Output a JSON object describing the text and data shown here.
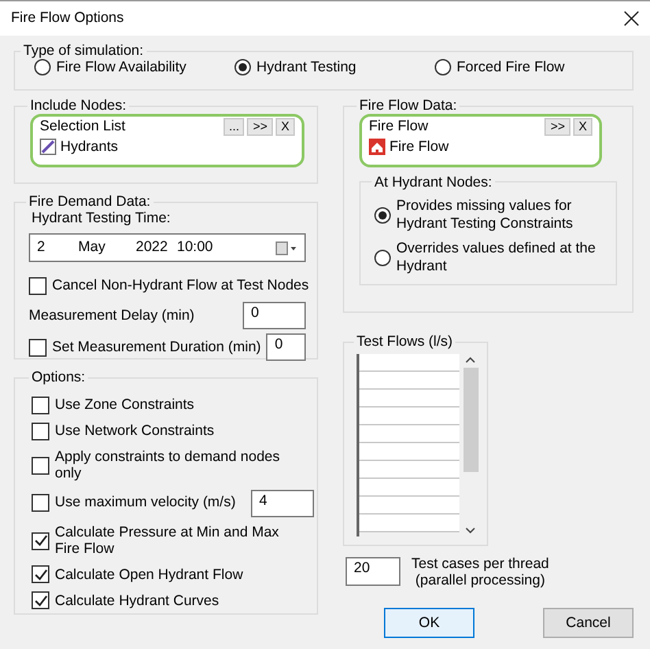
{
  "window": {
    "title": "Fire Flow Options"
  },
  "simulation_type": {
    "label": "Type of simulation:",
    "options": [
      {
        "label": "Fire Flow Availability",
        "selected": false
      },
      {
        "label": "Hydrant Testing",
        "selected": true
      },
      {
        "label": "Forced Fire Flow",
        "selected": false
      }
    ]
  },
  "include_nodes": {
    "label": "Include Nodes:",
    "list_title": "Selection List",
    "buttons": [
      "...",
      ">>",
      "X"
    ],
    "items": [
      {
        "label": "Hydrants",
        "kind": "hydrant"
      }
    ]
  },
  "fire_flow_data": {
    "label": "Fire Flow Data:",
    "list_title": "Fire Flow",
    "buttons": [
      ">>",
      "X"
    ],
    "items": [
      {
        "label": "Fire Flow",
        "kind": "fireflow"
      }
    ],
    "hydrant_nodes": {
      "label": "At Hydrant Nodes:",
      "options": [
        {
          "label": "Provides missing values for Hydrant Testing Constraints",
          "selected": true
        },
        {
          "label": "Overrides values defined at the Hydrant",
          "selected": false
        }
      ]
    }
  },
  "fire_demand": {
    "label": "Fire Demand Data:",
    "time_label": "Hydrant Testing Time:",
    "date": {
      "day": "2",
      "month": "May",
      "year": "2022",
      "time": "10:00"
    },
    "rows": [
      {
        "kind": "checkbox",
        "label": "Cancel Non-Hydrant Flow at Test Nodes",
        "checked": false
      },
      {
        "kind": "field",
        "label": "Measurement Delay (min)",
        "value": "0"
      },
      {
        "kind": "checkbox_field",
        "label": "Set Measurement Duration (min)",
        "checked": false,
        "value": "0"
      }
    ]
  },
  "options": {
    "label": "Options:",
    "items": [
      {
        "label": "Use Zone Constraints",
        "checked": false
      },
      {
        "label": "Use Network Constraints",
        "checked": false
      },
      {
        "label": "Apply constraints to demand nodes only",
        "checked": false
      },
      {
        "label": "Use maximum velocity (m/s)",
        "checked": false,
        "value": "4"
      },
      {
        "label": "Calculate Pressure at Min and Max Fire Flow",
        "checked": true
      },
      {
        "label": "Calculate Open Hydrant Flow",
        "checked": true
      },
      {
        "label": "Calculate Hydrant Curves",
        "checked": true
      }
    ]
  },
  "test_flows": {
    "label": "Test Flows (l/s)"
  },
  "test_cases": {
    "value": "20",
    "label": "Test cases per thread\n(parallel processing)"
  },
  "buttons": [
    {
      "label": "OK",
      "kind": "default"
    },
    {
      "label": "Cancel",
      "kind": "normal"
    }
  ]
}
